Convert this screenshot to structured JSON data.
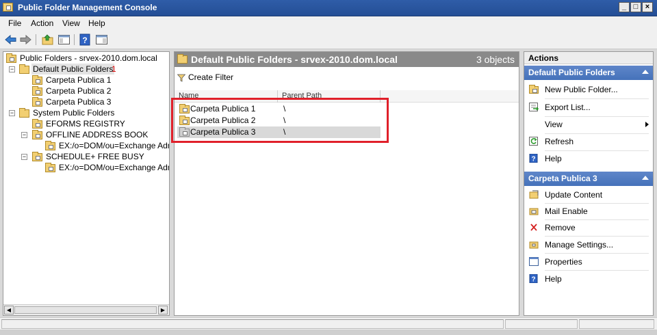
{
  "window": {
    "title": "Public Folder Management Console",
    "controls": {
      "minimize": "_",
      "maximize": "□",
      "close": "×"
    }
  },
  "menu": [
    "File",
    "Action",
    "View",
    "Help"
  ],
  "toolbar": {
    "buttons": [
      "back-arrow-icon",
      "forward-arrow-icon",
      "up-folder-icon",
      "show-hide-tree-icon",
      "help-icon",
      "show-hide-action-pane-icon"
    ]
  },
  "tree": {
    "root": "Public Folders - srvex-2010.dom.local",
    "default_folders": "Default Public Folders",
    "default_folders_annotation": "1",
    "carpeta1": "Carpeta Publica 1",
    "carpeta2": "Carpeta Publica 2",
    "carpeta3": "Carpeta Publica 3",
    "system_folders": "System Public Folders",
    "eforms": "EFORMS REGISTRY",
    "oab": "OFFLINE ADDRESS BOOK",
    "oab_child": "EX:/o=DOM/ou=Exchange Admini",
    "schedule": "SCHEDULE+ FREE BUSY",
    "schedule_child": "EX:/o=DOM/ou=Exchange Admini",
    "expand_minus": "−"
  },
  "center": {
    "title": "Default Public Folders - srvex-2010.dom.local",
    "count": "3 objects",
    "create_filter": "Create Filter",
    "columns": {
      "name": "Name",
      "parent_path": "Parent Path"
    },
    "rows": [
      {
        "name": "Carpeta Publica 1",
        "path": "\\"
      },
      {
        "name": "Carpeta Publica 2",
        "path": "\\"
      },
      {
        "name": "Carpeta Publica 3",
        "path": "\\"
      }
    ]
  },
  "actions": {
    "title": "Actions",
    "section1": {
      "header": "Default Public Folders",
      "items": [
        "New Public Folder...",
        "Export List...",
        "View",
        "Refresh",
        "Help"
      ]
    },
    "section2": {
      "header": "Carpeta Publica 3",
      "items": [
        "Update Content",
        "Mail Enable",
        "Remove",
        "Manage Settings...",
        "Properties",
        "Help"
      ]
    }
  },
  "colors": {
    "title_bar": "#2f5da8",
    "action_header": "#4572ba",
    "center_header": "#8a8a8a",
    "highlight_box": "#e0202a",
    "annotation": "#d40000"
  }
}
